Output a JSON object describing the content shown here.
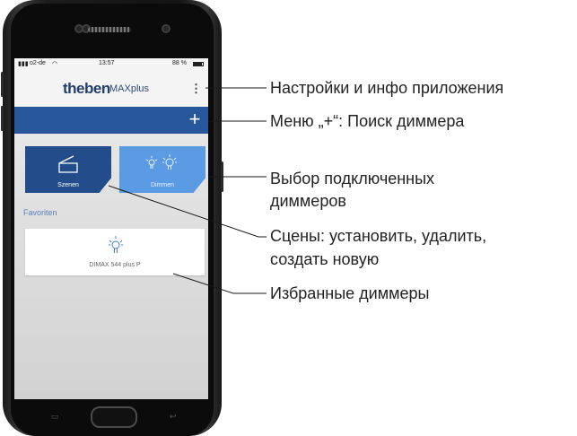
{
  "status_bar": {
    "carrier": "o2-de",
    "time": "13:57",
    "battery": "88 %"
  },
  "app_header": {
    "brand": "theben",
    "brand_suffix": "MAXplus",
    "menu_icon": "kebab-menu-icon"
  },
  "toolbar": {
    "add_label": "+"
  },
  "tiles": [
    {
      "label": "Szenen",
      "icon": "scene-icon",
      "selected": true
    },
    {
      "label": "Dimmen",
      "icon": "bulb-icon",
      "selected": false
    }
  ],
  "favorites": {
    "section_label": "Favoriten",
    "items": [
      {
        "name": "DIMAX 544 plus P",
        "icon": "bulb-icon"
      }
    ]
  },
  "callouts": {
    "settings": "Настройки и инфо приложения",
    "plus_menu": "Меню „+“: Поиск диммера",
    "select_line1": "Выбор подключенных",
    "select_line2": "диммеров",
    "scenes_line1": "Сцены: установить, удалить,",
    "scenes_line2": "создать новую",
    "favorites": "Избранные диммеры"
  },
  "colors": {
    "brand_blue": "#27569b",
    "tile_dark": "#234d8a",
    "tile_light": "#5a9be3",
    "section_label": "#5a7fbd"
  }
}
